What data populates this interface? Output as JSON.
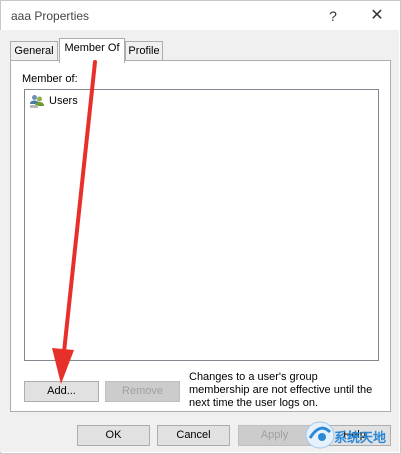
{
  "window": {
    "title": "aaa Properties",
    "help_glyph": "?",
    "close_glyph": "✕"
  },
  "tabs": [
    {
      "label": "General",
      "active": false
    },
    {
      "label": "Member Of",
      "active": true
    },
    {
      "label": "Profile",
      "active": false
    }
  ],
  "member_of": {
    "label": "Member of:",
    "items": [
      {
        "name": "Users",
        "icon": "group-users-icon"
      }
    ]
  },
  "buttons": {
    "add": "Add...",
    "remove": "Remove",
    "ok": "OK",
    "cancel": "Cancel",
    "apply": "Apply",
    "help": "Help"
  },
  "note": "Changes to a user's group membership are not effective until the next time the user logs on.",
  "watermark": "系统天地",
  "colors": {
    "arrow": "#e8302a",
    "watermark": "#2a8ad8"
  }
}
